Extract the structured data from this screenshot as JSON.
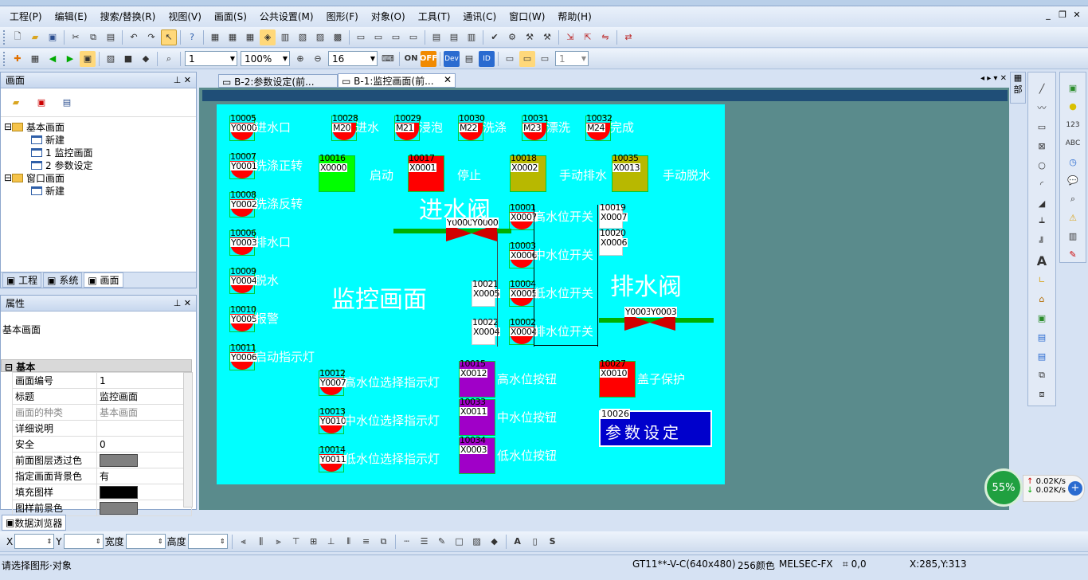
{
  "menu": [
    "工程(P)",
    "编辑(E)",
    "搜索/替换(R)",
    "视图(V)",
    "画面(S)",
    "公共设置(M)",
    "图形(F)",
    "对象(O)",
    "工具(T)",
    "通讯(C)",
    "窗口(W)",
    "帮助(H)"
  ],
  "toolbar2": {
    "layer": "1",
    "zoom": "100%",
    "grid": "16",
    "on_label": "ON",
    "off_label": "OFF",
    "dev_label": "Dev",
    "id_label": "ID",
    "dropdown_val": "1"
  },
  "tabs": [
    {
      "label": "B-2:参数设定(前..."
    },
    {
      "label": "B-1:监控画面(前..."
    }
  ],
  "screen_panel": {
    "title": "画面",
    "tree": {
      "root1": "基本画面",
      "new1": "新建",
      "item1": "1  监控画面",
      "item2": "2  参数设定",
      "root2": "窗口画面",
      "new2": "新建"
    },
    "bottom_tabs": [
      "工程",
      "系统",
      "画面"
    ]
  },
  "prop_panel": {
    "title": "属性",
    "subtitle": "基本画面",
    "section": "基本",
    "rows": [
      {
        "k": "画面编号",
        "v": "1"
      },
      {
        "k": "标题",
        "v": "监控画面"
      },
      {
        "k": "画面的种类",
        "v": "基本画面"
      },
      {
        "k": "详细说明",
        "v": ""
      },
      {
        "k": "安全",
        "v": "0"
      },
      {
        "k": "前面图层透过色",
        "v": ""
      },
      {
        "k": "指定画面背景色",
        "v": "有"
      },
      {
        "k": "填充图样",
        "v": ""
      },
      {
        "k": "图样前景色",
        "v": ""
      }
    ]
  },
  "data_browser": {
    "label": "数据浏览器"
  },
  "bottom_toolbar": {
    "x": "X",
    "y": "Y",
    "width": "宽度",
    "height": "高度"
  },
  "status": {
    "hint": "请选择图形·对象",
    "model": "GT11**-V-C(640x480)",
    "colors": "256颜色",
    "plc": "MELSEC-FX",
    "offset": "0,0",
    "coords": "X:285,Y:313"
  },
  "net": {
    "percent": "55%",
    "up": "0.02K/s",
    "down": "0.02K/s"
  },
  "hmi": {
    "lamps": [
      {
        "id": "10005",
        "addr": "Y0000",
        "label": "进水口"
      },
      {
        "id": "10028",
        "addr": "M20",
        "label": "进水"
      },
      {
        "id": "10029",
        "addr": "M21",
        "label": "浸泡"
      },
      {
        "id": "10030",
        "addr": "M22",
        "label": "洗涤"
      },
      {
        "id": "10031",
        "addr": "M23",
        "label": "漂洗"
      },
      {
        "id": "10032",
        "addr": "M24",
        "label": "完成"
      },
      {
        "id": "10007",
        "addr": "Y0001",
        "label": "洗涤正转"
      },
      {
        "id": "10008",
        "addr": "Y0002",
        "label": "洗涤反转"
      },
      {
        "id": "10006",
        "addr": "Y0003",
        "label": "排水口"
      },
      {
        "id": "10009",
        "addr": "Y0004",
        "label": "脱水"
      },
      {
        "id": "10010",
        "addr": "Y0005",
        "label": "报警"
      },
      {
        "id": "10011",
        "addr": "Y0006",
        "label": "启动指示灯"
      },
      {
        "id": "10001",
        "addr": "X0007",
        "label": "高水位开关"
      },
      {
        "id": "10003",
        "addr": "X0006",
        "label": "中水位开关"
      },
      {
        "id": "10004",
        "addr": "X0005",
        "label": "低水位开关"
      },
      {
        "id": "10002",
        "addr": "X0004",
        "label": "排水位开关"
      },
      {
        "id": "10012",
        "addr": "Y0007",
        "label": "高水位选择指示灯"
      },
      {
        "id": "10013",
        "addr": "Y0010",
        "label": "中水位选择指示灯"
      },
      {
        "id": "10014",
        "addr": "Y0011",
        "label": "低水位选择指示灯"
      }
    ],
    "buttons": [
      {
        "id": "10016",
        "addr": "X0000",
        "label": "启动"
      },
      {
        "id": "10017",
        "addr": "X0001",
        "label": "停止"
      },
      {
        "id": "10018",
        "addr": "X0002",
        "label": "手动排水"
      },
      {
        "id": "10035",
        "addr": "X0013",
        "label": "手动脱水"
      },
      {
        "id": "10015",
        "addr": "X0012",
        "label": "高水位按钮"
      },
      {
        "id": "10033",
        "addr": "X0011",
        "label": "中水位按钮"
      },
      {
        "id": "10034",
        "addr": "X0003",
        "label": "低水位按钮"
      },
      {
        "id": "10027",
        "addr": "X0010",
        "label": "盖子保护"
      }
    ],
    "switches": [
      {
        "id": "10019",
        "addr": "X0007"
      },
      {
        "id": "10020",
        "addr": "X0006"
      },
      {
        "id": "10021",
        "addr": "X0005"
      },
      {
        "id": "10022",
        "addr": "X0004"
      }
    ],
    "valves": [
      {
        "a": "Y0000",
        "b": "Y0000"
      },
      {
        "a": "Y0003",
        "b": "Y0003"
      }
    ],
    "big_labels": {
      "inlet": "进水阀",
      "monitor": "监控画面",
      "drain": "排水阀"
    },
    "param_btn": {
      "id": "10026",
      "label": "参数设定"
    }
  },
  "colors": {
    "screen_bg": "#00ffff",
    "lamp_red": "#ff0000",
    "btn_green": "#00ff00",
    "btn_olive": "#b8b800",
    "btn_purple": "#a000c8",
    "param_blue": "#0000cc"
  }
}
